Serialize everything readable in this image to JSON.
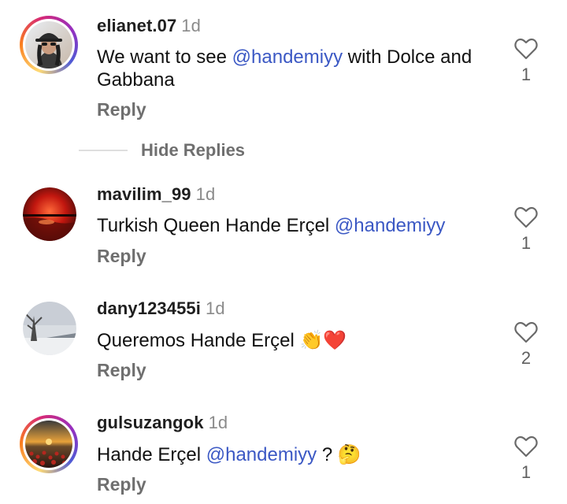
{
  "comments": [
    {
      "username": "elianet.07",
      "time": "1d",
      "text_before": "We want to see ",
      "mention": "@handemiyy",
      "text_after": " with Dolce and Gabbana",
      "reply_label": "Reply",
      "like_count": "1",
      "has_story_ring": true,
      "avatar_icon": "avatar-woman-bucket-hat"
    },
    {
      "username": "mavilim_99",
      "time": "1d",
      "text_before": "Turkish Queen Hande Erçel ",
      "mention": "@handemiyy",
      "text_after": "",
      "reply_label": "Reply",
      "like_count": "1",
      "has_story_ring": false,
      "avatar_icon": "avatar-red-sunset"
    },
    {
      "username": "dany123455i",
      "time": "1d",
      "text_before": "Queremos Hande Erçel ",
      "emojis": "👏❤️",
      "reply_label": "Reply",
      "like_count": "2",
      "has_story_ring": false,
      "avatar_icon": "avatar-winter-tree"
    },
    {
      "username": "gulsuzangok",
      "time": "1d",
      "text_before": "Hande Erçel ",
      "mention": "@handemiyy",
      "text_after": " ? ",
      "emojis": "🤔",
      "reply_label": "Reply",
      "like_count": "1",
      "has_story_ring": true,
      "avatar_icon": "avatar-tulip-field"
    }
  ],
  "hide_replies_label": "Hide Replies",
  "colors": {
    "mention": "#3b58c4",
    "muted": "#6f6f6f",
    "time": "#8a8a8a"
  }
}
